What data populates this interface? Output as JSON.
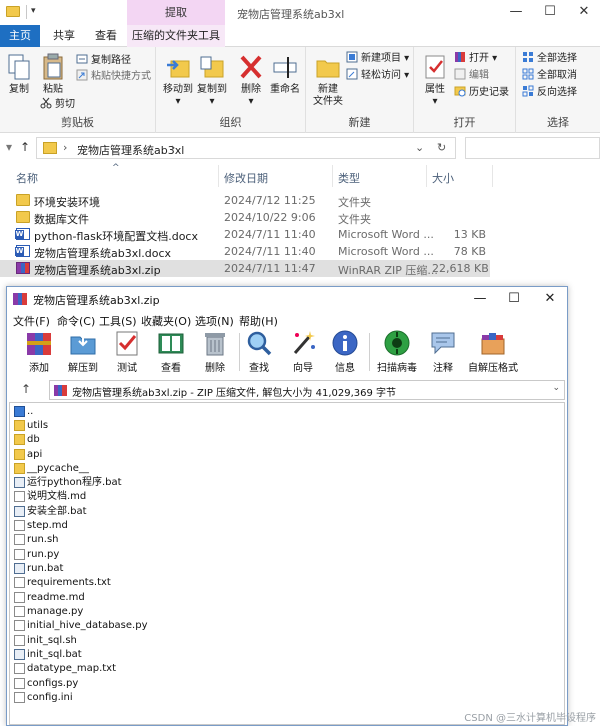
{
  "explorer": {
    "window_title": "宠物店管理系统ab3xl",
    "ribbon_tabs": [
      "主页",
      "共享",
      "查看",
      "压缩的文件夹工具"
    ],
    "context_tab_label": "提取",
    "groups": {
      "clipboard": {
        "label": "剪贴板",
        "copy": "复制",
        "paste": "粘贴",
        "copy_path": "复制路径",
        "paste_shortcut": "粘贴快捷方式",
        "cut": "剪切"
      },
      "organize": {
        "label": "组织",
        "move_to": "移动到",
        "copy_to": "复制到",
        "delete": "删除",
        "rename": "重命名"
      },
      "new": {
        "label": "新建",
        "new_folder": "新建\n文件夹",
        "new_folder_line1": "新建",
        "new_folder_line2": "文件夹",
        "new_item": "新建项目",
        "easy_access": "轻松访问"
      },
      "open": {
        "label": "打开",
        "properties": "属性",
        "open": "打开",
        "edit": "编辑",
        "history": "历史记录"
      },
      "select": {
        "label": "选择",
        "select_all": "全部选择",
        "select_none": "全部取消",
        "invert": "反向选择"
      }
    },
    "address": "宠物店管理系统ab3xl",
    "columns": [
      "名称",
      "修改日期",
      "类型",
      "大小"
    ],
    "files": [
      {
        "name": "环境安装环境",
        "date": "2024/7/12 11:25",
        "type": "文件夹",
        "size": "",
        "icon": "folder-icon"
      },
      {
        "name": "数据库文件",
        "date": "2024/10/22 9:06",
        "type": "文件夹",
        "size": "",
        "icon": "folder-icon"
      },
      {
        "name": "python-flask环境配置文档.docx",
        "date": "2024/7/11 11:40",
        "type": "Microsoft Word ...",
        "size": "13 KB",
        "icon": "word-doc-icon"
      },
      {
        "name": "宠物店管理系统ab3xl.docx",
        "date": "2024/7/11 11:40",
        "type": "Microsoft Word ...",
        "size": "78 KB",
        "icon": "word-doc-icon"
      },
      {
        "name": "宠物店管理系统ab3xl.zip",
        "date": "2024/7/11 11:47",
        "type": "WinRAR ZIP 压缩...",
        "size": "22,618 KB",
        "icon": "winrar-archive-icon",
        "selected": true
      }
    ]
  },
  "winrar": {
    "title": "宠物店管理系统ab3xl.zip",
    "menu": [
      "文件(F)",
      "命令(C)",
      "工具(S)",
      "收藏夹(O)",
      "选项(N)",
      "帮助(H)"
    ],
    "toolbar": [
      "添加",
      "解压到",
      "测试",
      "查看",
      "删除",
      "查找",
      "向导",
      "信息",
      "扫描病毒",
      "注释",
      "自解压格式"
    ],
    "path": "宠物店管理系统ab3xl.zip - ZIP 压缩文件, 解包大小为 41,029,369 字节",
    "entries": [
      {
        "name": "..",
        "kind": "up"
      },
      {
        "name": "utils",
        "kind": "folder"
      },
      {
        "name": "db",
        "kind": "folder"
      },
      {
        "name": "api",
        "kind": "folder"
      },
      {
        "name": "__pycache__",
        "kind": "folder"
      },
      {
        "name": "运行python程序.bat",
        "kind": "bat"
      },
      {
        "name": "说明文档.md",
        "kind": "file"
      },
      {
        "name": "安装全部.bat",
        "kind": "bat"
      },
      {
        "name": "step.md",
        "kind": "file"
      },
      {
        "name": "run.sh",
        "kind": "file"
      },
      {
        "name": "run.py",
        "kind": "file"
      },
      {
        "name": "run.bat",
        "kind": "bat"
      },
      {
        "name": "requirements.txt",
        "kind": "file"
      },
      {
        "name": "readme.md",
        "kind": "file"
      },
      {
        "name": "manage.py",
        "kind": "file"
      },
      {
        "name": "initial_hive_database.py",
        "kind": "file"
      },
      {
        "name": "init_sql.sh",
        "kind": "file"
      },
      {
        "name": "init_sql.bat",
        "kind": "bat"
      },
      {
        "name": "datatype_map.txt",
        "kind": "file"
      },
      {
        "name": "configs.py",
        "kind": "file"
      },
      {
        "name": "config.ini",
        "kind": "file"
      }
    ]
  },
  "watermark": "CSDN @三水计算机毕设程序",
  "colors": {
    "accent": "#1e6fc2",
    "context_tab": "#f3d6f3",
    "selection": "#e0e0e0"
  }
}
